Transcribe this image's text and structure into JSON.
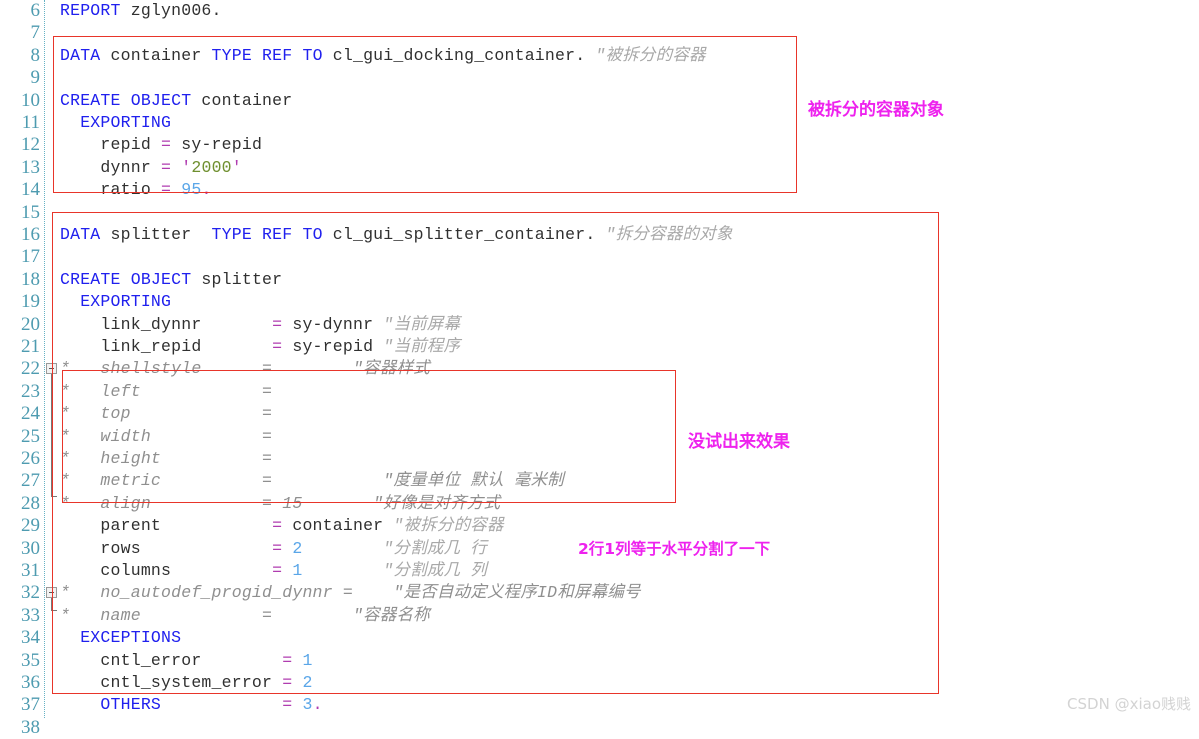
{
  "editor": {
    "language": "ABAP",
    "gutter_color": "#4e9bb0",
    "keyword_color": "#2020ee",
    "number_color": "#5aa6e8",
    "operator_color": "#b03cb0",
    "string_color": "#6f8f2f",
    "comment_color": "#a8a8a8",
    "annotation_color": "#ee22ee",
    "box_color": "#e8352a",
    "first_line": 6,
    "last_line": 38
  },
  "lines": [
    {
      "n": "6",
      "segments": [
        {
          "t": "REPORT ",
          "c": "kw"
        },
        {
          "t": "zglyn006.",
          "c": "id"
        }
      ]
    },
    {
      "n": "7",
      "segments": []
    },
    {
      "n": "8",
      "segments": [
        {
          "t": "DATA",
          "c": "kw"
        },
        {
          "t": " container ",
          "c": "id"
        },
        {
          "t": "TYPE REF TO",
          "c": "kw"
        },
        {
          "t": " cl_gui_docking_container. ",
          "c": "id"
        },
        {
          "t": "\"被拆分的容器",
          "c": "cmt"
        }
      ]
    },
    {
      "n": "9",
      "segments": []
    },
    {
      "n": "10",
      "segments": [
        {
          "t": "CREATE OBJECT",
          "c": "kw"
        },
        {
          "t": " container",
          "c": "id"
        }
      ]
    },
    {
      "n": "11",
      "segments": [
        {
          "t": "  EXPORTING",
          "c": "kw"
        }
      ]
    },
    {
      "n": "12",
      "segments": [
        {
          "t": "    repid ",
          "c": "id"
        },
        {
          "t": "=",
          "c": "op"
        },
        {
          "t": " sy-repid",
          "c": "id"
        }
      ]
    },
    {
      "n": "13",
      "segments": [
        {
          "t": "    dynnr ",
          "c": "id"
        },
        {
          "t": "=",
          "c": "op"
        },
        {
          "t": " ",
          "c": "id"
        },
        {
          "t": "'",
          "c": "quo"
        },
        {
          "t": "2000",
          "c": "str"
        },
        {
          "t": "'",
          "c": "quo"
        }
      ]
    },
    {
      "n": "14",
      "segments": [
        {
          "t": "    ratio ",
          "c": "id"
        },
        {
          "t": "=",
          "c": "op"
        },
        {
          "t": " ",
          "c": "id"
        },
        {
          "t": "95",
          "c": "num"
        },
        {
          "t": ".",
          "c": "op"
        }
      ]
    },
    {
      "n": "15",
      "segments": []
    },
    {
      "n": "16",
      "segments": [
        {
          "t": "DATA",
          "c": "kw"
        },
        {
          "t": " splitter  ",
          "c": "id"
        },
        {
          "t": "TYPE REF TO",
          "c": "kw"
        },
        {
          "t": " cl_gui_splitter_container. ",
          "c": "id"
        },
        {
          "t": "\"拆分容器的对象",
          "c": "cmt"
        }
      ]
    },
    {
      "n": "17",
      "segments": []
    },
    {
      "n": "18",
      "segments": [
        {
          "t": "CREATE OBJECT",
          "c": "kw"
        },
        {
          "t": " splitter",
          "c": "id"
        }
      ]
    },
    {
      "n": "19",
      "segments": [
        {
          "t": "  EXPORTING",
          "c": "kw"
        }
      ]
    },
    {
      "n": "20",
      "segments": [
        {
          "t": "    link_dynnr       ",
          "c": "id"
        },
        {
          "t": "=",
          "c": "op"
        },
        {
          "t": " sy-dynnr ",
          "c": "id"
        },
        {
          "t": "\"当前屏幕",
          "c": "cmt"
        }
      ]
    },
    {
      "n": "21",
      "segments": [
        {
          "t": "    link_repid       ",
          "c": "id"
        },
        {
          "t": "=",
          "c": "op"
        },
        {
          "t": " sy-repid ",
          "c": "id"
        },
        {
          "t": "\"当前程序",
          "c": "cmt"
        }
      ]
    },
    {
      "n": "22",
      "segments": [
        {
          "t": "*   shellstyle      =        \"容器样式",
          "c": "cmtb"
        }
      ],
      "fold": "start"
    },
    {
      "n": "23",
      "segments": [
        {
          "t": "*   left            =",
          "c": "cmtb"
        }
      ]
    },
    {
      "n": "24",
      "segments": [
        {
          "t": "*   top             =",
          "c": "cmtb"
        }
      ]
    },
    {
      "n": "25",
      "segments": [
        {
          "t": "*   width           =",
          "c": "cmtb"
        }
      ]
    },
    {
      "n": "26",
      "segments": [
        {
          "t": "*   height          =",
          "c": "cmtb"
        }
      ]
    },
    {
      "n": "27",
      "segments": [
        {
          "t": "*   metric          =           \"度量单位 默认 毫米制",
          "c": "cmtb"
        }
      ]
    },
    {
      "n": "28",
      "segments": [
        {
          "t": "*   align           = 15       \"好像是对齐方式",
          "c": "cmtb"
        }
      ],
      "fold": "end"
    },
    {
      "n": "29",
      "segments": [
        {
          "t": "    parent           ",
          "c": "id"
        },
        {
          "t": "=",
          "c": "op"
        },
        {
          "t": " container ",
          "c": "id"
        },
        {
          "t": "\"被拆分的容器",
          "c": "cmt"
        }
      ]
    },
    {
      "n": "30",
      "segments": [
        {
          "t": "    rows             ",
          "c": "id"
        },
        {
          "t": "=",
          "c": "op"
        },
        {
          "t": " ",
          "c": "id"
        },
        {
          "t": "2",
          "c": "num"
        },
        {
          "t": "        ",
          "c": "id"
        },
        {
          "t": "\"分割成几 行",
          "c": "cmt"
        }
      ]
    },
    {
      "n": "31",
      "segments": [
        {
          "t": "    columns          ",
          "c": "id"
        },
        {
          "t": "=",
          "c": "op"
        },
        {
          "t": " ",
          "c": "id"
        },
        {
          "t": "1",
          "c": "num"
        },
        {
          "t": "        ",
          "c": "id"
        },
        {
          "t": "\"分割成几 列",
          "c": "cmt"
        }
      ]
    },
    {
      "n": "32",
      "segments": [
        {
          "t": "*   no_autodef_progid_dynnr =    \"是否自动定义程序ID和屏幕编号",
          "c": "cmtb"
        }
      ],
      "fold": "start"
    },
    {
      "n": "33",
      "segments": [
        {
          "t": "*   name            =        \"容器名称",
          "c": "cmtb"
        }
      ],
      "fold": "end"
    },
    {
      "n": "34",
      "segments": [
        {
          "t": "  EXCEPTIONS",
          "c": "kw"
        }
      ]
    },
    {
      "n": "35",
      "segments": [
        {
          "t": "    cntl_error        ",
          "c": "id"
        },
        {
          "t": "=",
          "c": "op"
        },
        {
          "t": " ",
          "c": "id"
        },
        {
          "t": "1",
          "c": "num"
        }
      ]
    },
    {
      "n": "36",
      "segments": [
        {
          "t": "    cntl_system_error ",
          "c": "id"
        },
        {
          "t": "=",
          "c": "op"
        },
        {
          "t": " ",
          "c": "id"
        },
        {
          "t": "2",
          "c": "num"
        }
      ]
    },
    {
      "n": "37",
      "segments": [
        {
          "t": "    OTHERS",
          "c": "kw"
        },
        {
          "t": "            ",
          "c": "id"
        },
        {
          "t": "=",
          "c": "op"
        },
        {
          "t": " ",
          "c": "id"
        },
        {
          "t": "3",
          "c": "num"
        },
        {
          "t": ".",
          "c": "op"
        }
      ]
    },
    {
      "n": "38",
      "segments": []
    }
  ],
  "annotations": [
    {
      "id": "anno-container-object",
      "text": "被拆分的容器对象"
    },
    {
      "id": "anno-no-effect",
      "text": "没试出来效果"
    },
    {
      "id": "anno-rows-cols",
      "text": "2行1列等于水平分割了一下"
    }
  ],
  "watermark": {
    "text": "CSDN @xiao贱贱"
  }
}
